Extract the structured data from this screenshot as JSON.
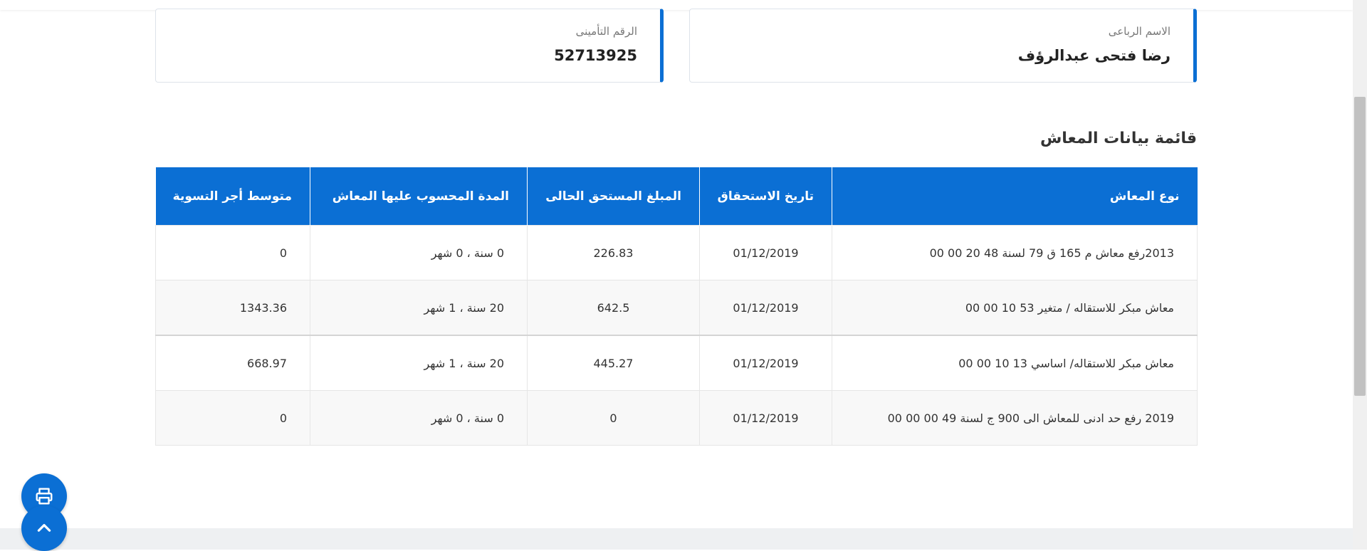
{
  "profile": {
    "full_name_label": "الاسم الرباعى",
    "full_name_value": "رضا فتحى عبدالرؤف",
    "insurance_number_label": "الرقم التأمينى",
    "insurance_number_value": "52713925"
  },
  "pension_list": {
    "title": "قائمة بيانات المعاش",
    "columns": [
      "نوع المعاش",
      "تاريخ الاستحقاق",
      "المبلغ المستحق الحالى",
      "المدة المحسوب عليها المعاش",
      "متوسط أجر التسوية"
    ],
    "rows": [
      [
        "2013رفع معاش م 165 ق 79 لسنة 48 20 00 00",
        "01/12/2019",
        "226.83",
        "0 سنة ، 0 شهر",
        "0"
      ],
      [
        "معاش مبكر للاستقاله / متغير 53 10 00 00",
        "01/12/2019",
        "642.5",
        "20 سنة ، 1 شهر",
        "1343.36"
      ],
      [
        "معاش مبكر للاستقاله/ اساسي 13 10 00 00",
        "01/12/2019",
        "445.27",
        "20 سنة ، 1 شهر",
        "668.97"
      ],
      [
        "2019 رفع حد ادنى للمعاش الى 900 ج لسنة 49 00 00 00",
        "01/12/2019",
        "0",
        "0 سنة ، 0 شهر",
        "0"
      ]
    ]
  },
  "icons": {
    "print": "printer-icon",
    "scroll_top": "chevron-up-icon"
  },
  "colors": {
    "primary": "#0b6fd4",
    "row_alt": "#f8f8f8"
  }
}
